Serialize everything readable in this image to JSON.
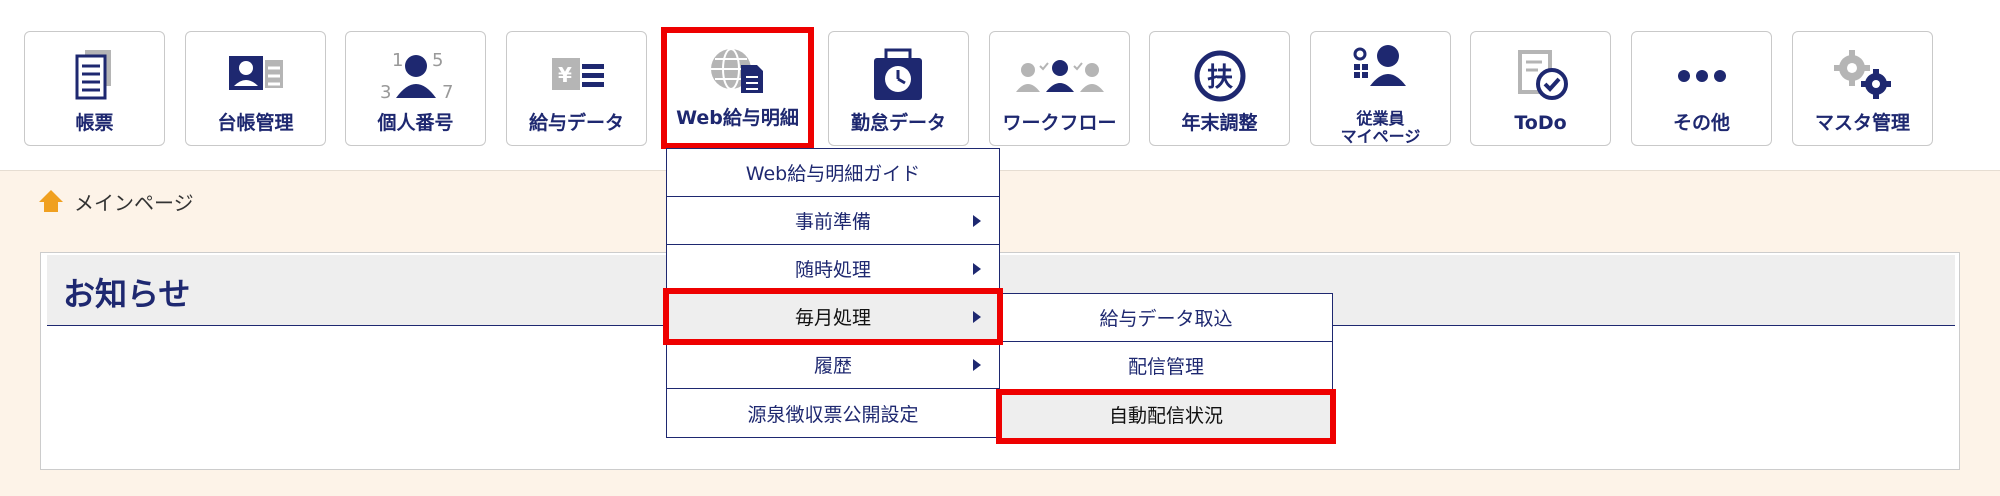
{
  "toolbar": {
    "items": [
      {
        "label": "帳票",
        "icon": "report-icon"
      },
      {
        "label": "台帳管理",
        "icon": "ledger-icon"
      },
      {
        "label": "個人番号",
        "icon": "personal-number-icon"
      },
      {
        "label": "給与データ",
        "icon": "salary-data-icon"
      },
      {
        "label": "Web給与明細",
        "icon": "web-payslip-icon"
      },
      {
        "label": "勤怠データ",
        "icon": "attendance-icon"
      },
      {
        "label": "ワークフロー",
        "icon": "workflow-icon"
      },
      {
        "label": "年末調整",
        "icon": "year-end-adjustment-icon"
      },
      {
        "label": "従業員\nマイページ",
        "label_line1": "従業員",
        "label_line2": "マイページ",
        "icon": "employee-mypage-icon"
      },
      {
        "label": "ToDo",
        "icon": "todo-icon"
      },
      {
        "label": "その他",
        "icon": "more-icon"
      },
      {
        "label": "マスタ管理",
        "icon": "master-settings-icon"
      }
    ],
    "personal_number_digits": [
      "1",
      "5",
      "3",
      "7"
    ],
    "tax_icon_char": "扶",
    "yen_char": "¥"
  },
  "breadcrumb": {
    "home_label": "メインページ",
    "icon": "home-icon"
  },
  "notice": {
    "title": "お知らせ"
  },
  "dropdown": {
    "items": [
      {
        "label": "Web給与明細ガイド",
        "has_submenu": false
      },
      {
        "label": "事前準備",
        "has_submenu": true
      },
      {
        "label": "随時処理",
        "has_submenu": true
      },
      {
        "label": "毎月処理",
        "has_submenu": true,
        "selected": true
      },
      {
        "label": "履歴",
        "has_submenu": true
      },
      {
        "label": "源泉徴収票公開設定",
        "has_submenu": false
      }
    ]
  },
  "submenu": {
    "items": [
      {
        "label": "給与データ取込"
      },
      {
        "label": "配信管理"
      },
      {
        "label": "自動配信状況",
        "selected": true
      }
    ]
  },
  "colors": {
    "navy": "#1e2870",
    "highlight_red": "#ee0000",
    "page_bg": "#fdf3e8",
    "icon_gray": "#b5b5b5",
    "home_orange": "#f0a020"
  }
}
